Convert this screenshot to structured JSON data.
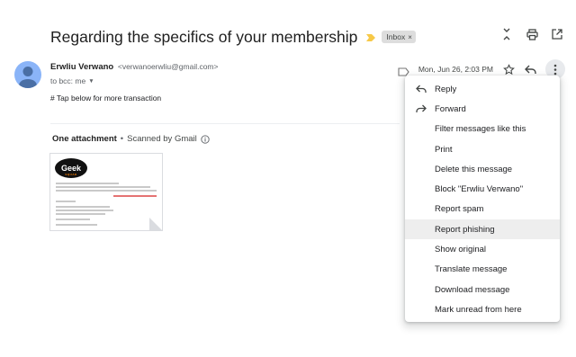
{
  "email": {
    "subject": "Regarding the specifics of your membership",
    "label": "Inbox",
    "label_close": "×",
    "sender_name": "Erwliu Verwano",
    "sender_email": "<verwanoerwliu@gmail.com>",
    "to_line": "to bcc: me",
    "date": "Mon, Jun 26, 2:03 PM",
    "body": "# Tap below for more transaction"
  },
  "attachments": {
    "count_label": "One attachment",
    "separator": "•",
    "scanned_label": "Scanned by Gmail",
    "thumbnail": {
      "brand": "Geek",
      "brand_sub": "SQUAD"
    }
  },
  "menu": {
    "items": [
      {
        "label": "Reply",
        "icon": "reply-icon"
      },
      {
        "label": "Forward",
        "icon": "forward-icon"
      },
      {
        "label": "Filter messages like this"
      },
      {
        "label": "Print"
      },
      {
        "label": "Delete this message"
      },
      {
        "label": "Block \"Erwliu Verwano\""
      },
      {
        "label": "Report spam"
      },
      {
        "label": "Report phishing",
        "highlighted": true
      },
      {
        "label": "Show original"
      },
      {
        "label": "Translate message"
      },
      {
        "label": "Download message"
      },
      {
        "label": "Mark unread from here"
      }
    ]
  },
  "colors": {
    "important_marker": "#f7c948",
    "avatar": "#8ab4f8",
    "menu_highlight": "#eeeeee"
  }
}
